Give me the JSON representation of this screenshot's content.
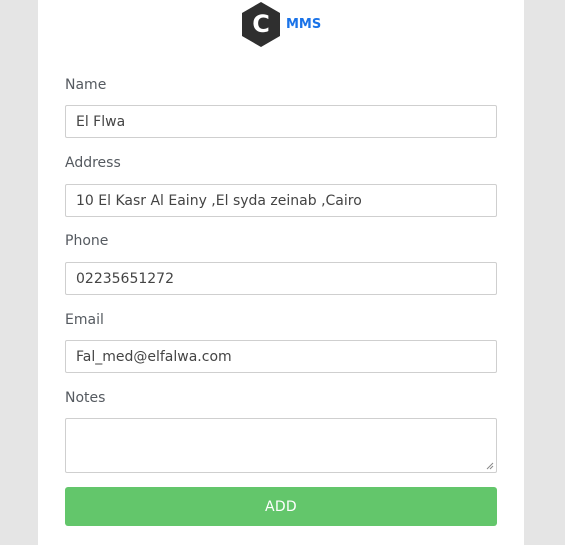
{
  "app": {
    "logo_letter": "C",
    "brand": "MMS"
  },
  "form": {
    "name_label": "Name",
    "name_value": "El Flwa",
    "address_label": "Address",
    "address_value": "10 El Kasr Al Eainy ,El syda zeinab ,Cairo",
    "phone_label": "Phone",
    "phone_value": "02235651272",
    "email_label": "Email",
    "email_value": "Fal_med@elfalwa.com",
    "notes_label": "Notes",
    "notes_value": "",
    "submit_label": "ADD"
  },
  "colors": {
    "accent": "#1a73e8",
    "submit": "#63c66b",
    "logo_hex": "#2f2f2f",
    "background": "#e5e5e5"
  }
}
